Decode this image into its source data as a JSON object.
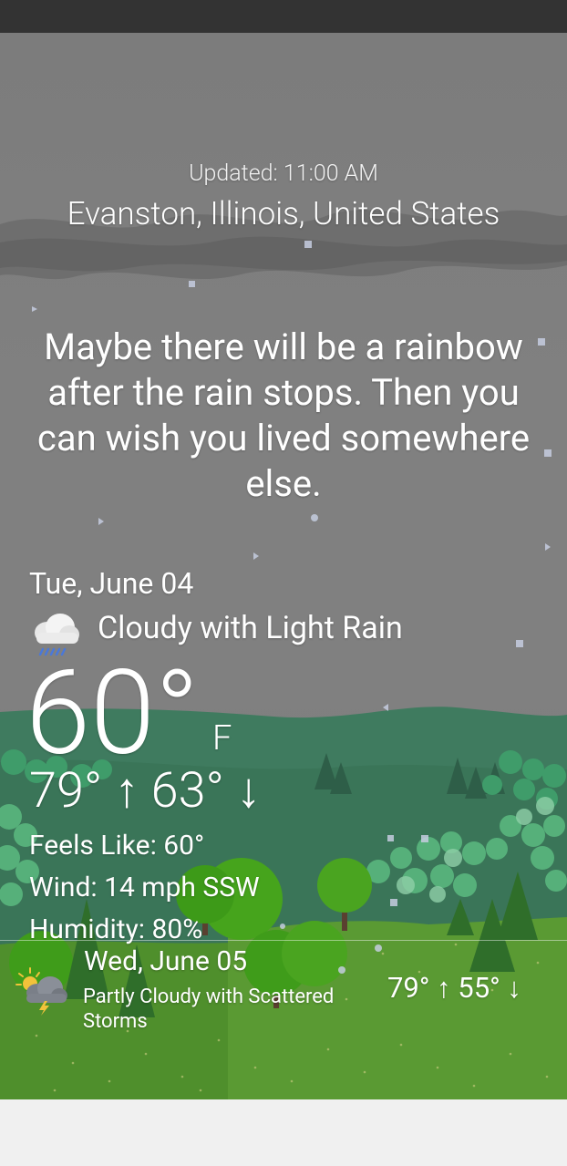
{
  "header": {
    "updated": "Updated: 11:00 AM",
    "location": "Evanston, Illinois, United States"
  },
  "quote": "Maybe there will be a rainbow after the rain stops. Then you can wish you lived somewhere else.",
  "current": {
    "date": "Tue, June 04",
    "condition": "Cloudy with Light Rain",
    "icon": "cloud-rain-icon",
    "temperature": "60°",
    "unit": "F",
    "hi_lo": "79° ↑ 63° ↓",
    "feels_like": "Feels Like: 60°",
    "wind": "Wind: 14 mph SSW",
    "humidity": "Humidity: 80%"
  },
  "forecast": [
    {
      "date": "Wed, June 05",
      "condition": "Partly Cloudy with Scattered Storms",
      "icon": "partly-cloudy-storm-icon",
      "hi_lo": "79° ↑  55° ↓"
    }
  ],
  "colors": {
    "sky": "#808080",
    "cloud_band": "#6a6a6a",
    "hills": "#3d7a5a",
    "grass": "#4e8f2a",
    "status_bar": "#333333",
    "nav_bar": "#f0f0f0"
  }
}
